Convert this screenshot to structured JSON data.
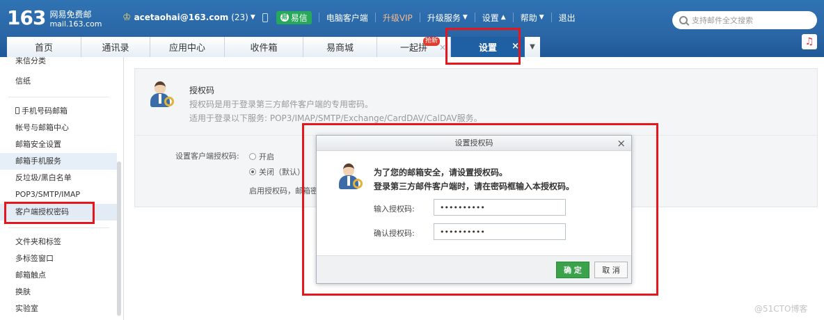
{
  "header": {
    "logo_num": "163",
    "logo_name": "网易免费邮",
    "logo_domain": "mail.163.com",
    "user_email": "acetaohai@163.com",
    "user_count": "(23)",
    "yixin_label": "易信",
    "nav": [
      "电脑客户端",
      "升级VIP",
      "升级服务",
      "设置",
      "帮助",
      "退出"
    ],
    "search_placeholder": "支持邮件全文搜索",
    "colors": {
      "bar": "#2b66a6",
      "vip": "#f5b98c",
      "yixin": "#27a85a"
    }
  },
  "tabs": [
    {
      "label": "首页"
    },
    {
      "label": "通讯录"
    },
    {
      "label": "应用中心"
    },
    {
      "label": "收件箱"
    },
    {
      "label": "易商城"
    },
    {
      "label": "一起拼",
      "badge": "抢新"
    },
    {
      "label": "设置"
    }
  ],
  "sidebar": {
    "items": [
      "来信分类",
      "信纸",
      "手机号码邮箱",
      "帐号与邮箱中心",
      "邮箱安全设置",
      "邮箱手机服务",
      "反垃圾/黑白名单",
      "POP3/SMTP/IMAP",
      "客户端授权密码",
      "文件夹和标签",
      "多标签窗口",
      "邮箱触点",
      "换肤",
      "实验室"
    ]
  },
  "panel": {
    "title": "授权码",
    "desc": "授权码是用于登录第三方邮件客户端的专用密码。",
    "services": "适用于登录以下服务: POP3/IMAP/SMTP/Exchange/CardDAV/CalDAV服务。",
    "option_label": "设置客户端授权码:",
    "opt_on": "开启",
    "opt_off": "关闭（默认）",
    "hint": "启用授权码，邮箱密码"
  },
  "dialog": {
    "title": "设置授权码",
    "msg1": "为了您的邮箱安全，请设置授权码。",
    "msg2": "登录第三方邮件客户端时，请在密码框输入本授权码。",
    "field1_label": "输入授权码:",
    "field1_value": "••••••••••",
    "field2_label": "确认授权码:",
    "field2_value": "••••••••••",
    "ok": "确 定",
    "cancel": "取 消"
  },
  "watermark": "@51CTO博客"
}
